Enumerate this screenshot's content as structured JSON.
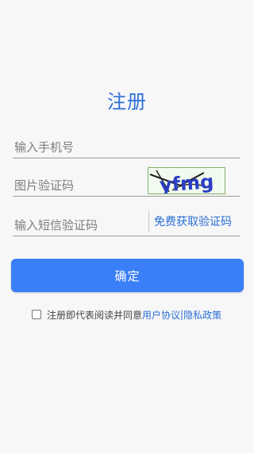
{
  "page": {
    "title": "注册"
  },
  "form": {
    "phone_placeholder": "输入手机号",
    "captcha_placeholder": "图片验证码",
    "captcha_image_text": "yfmg",
    "sms_placeholder": "输入短信验证码",
    "sms_button_label": "免费获取验证码",
    "confirm_label": "确定"
  },
  "agreement": {
    "prefix_text": "注册即代表阅读并同意",
    "user_agreement_link": "用户协议",
    "separator": "|",
    "privacy_policy_link": "隐私政策"
  },
  "colors": {
    "accent": "#3a7ff7",
    "link": "#2c6fd6",
    "background": "#f7f7f7"
  }
}
